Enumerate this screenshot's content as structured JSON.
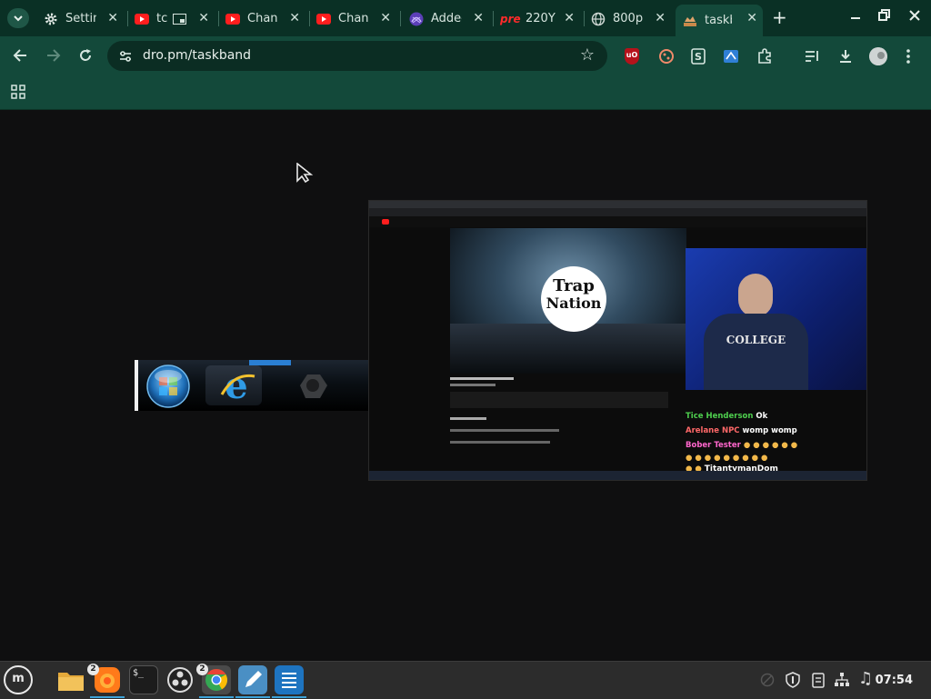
{
  "browser": {
    "tabs": [
      {
        "title": "Settings",
        "icon": "gear-icon",
        "active": false
      },
      {
        "title": "tc",
        "icon": "youtube-icon",
        "active": false
      },
      {
        "title": "Channel",
        "icon": "youtube-icon",
        "active": false
      },
      {
        "title": "Channel",
        "icon": "youtube-icon",
        "active": false
      },
      {
        "title": "Added",
        "icon": "globe-purple-icon",
        "active": false
      },
      {
        "title": "220Y",
        "icon": "pre-logo-icon",
        "active": false
      },
      {
        "title": "800p",
        "icon": "globe-icon",
        "active": false
      },
      {
        "title": "taskband",
        "icon": "taskband-icon",
        "active": true
      }
    ],
    "url": "dro.pm/taskband",
    "colors": {
      "tabstrip": "#0a3025",
      "toolbar": "#13493a"
    }
  },
  "page": {
    "taskbar_strip_icons": [
      "windows-orb-icon",
      "internet-explorer-icon",
      "dark-app-icon"
    ],
    "chat": [
      {
        "user": "Tice Henderson",
        "msg": "Ok",
        "color": "#4ecf4e"
      },
      {
        "user": "Arelane NPC",
        "msg": "womp womp",
        "color": "#ff6868"
      },
      {
        "user": "Bober Tester",
        "msg": "",
        "color": "#ff66cc"
      },
      {
        "user": "",
        "msg": "TitantymanDom",
        "color": "#ffffff"
      }
    ],
    "video_logo_line1": "Trap",
    "video_logo_line2": "Nation",
    "shirt_text": "COLLEGE"
  },
  "taskbar": {
    "apps": [
      {
        "name": "menu",
        "icon": "linux-mint-menu-icon"
      },
      {
        "name": "files",
        "icon": "folder-icon"
      },
      {
        "name": "firefox",
        "icon": "firefox-icon",
        "count": "2"
      },
      {
        "name": "terminal",
        "icon": "terminal-icon"
      },
      {
        "name": "obs",
        "icon": "obs-icon"
      },
      {
        "name": "chrome",
        "icon": "chrome-icon",
        "count": "2"
      },
      {
        "name": "text-editor",
        "icon": "pencil-editor-icon"
      },
      {
        "name": "writer",
        "icon": "document-icon"
      }
    ],
    "clock": "07:54",
    "tray_icons": [
      "blocked-icon",
      "shield-icon",
      "clipboard-icon",
      "network-icon",
      "music-note-icon"
    ]
  }
}
